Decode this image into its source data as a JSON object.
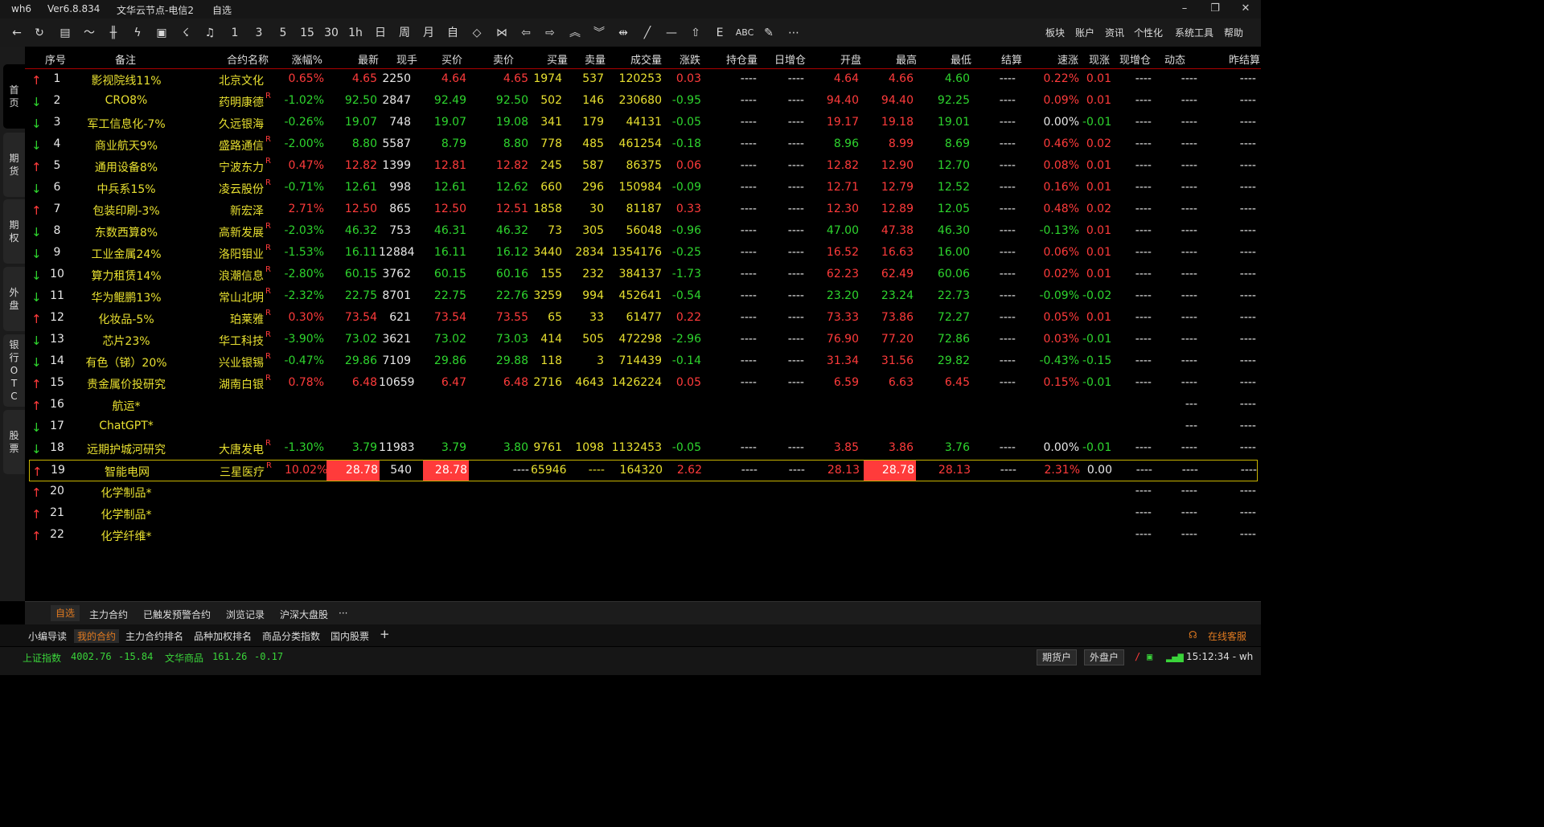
{
  "titlebar": {
    "app": "wh6",
    "version": "Ver6.8.834",
    "node": "文华云节点-电信2",
    "page": "自选"
  },
  "toolbar": {
    "icons": [
      "back-icon",
      "refresh-icon",
      "table-icon",
      "line-chart-icon",
      "candlestick-icon",
      "lightning-icon",
      "tape-icon",
      "cloud-lightning-icon",
      "bell-icon"
    ],
    "periods": [
      "1",
      "3",
      "5",
      "15",
      "30",
      "1h",
      "日",
      "周",
      "月",
      "自"
    ],
    "tools": [
      "diamond-icon",
      "bowtie-icon",
      "arrow-left-icon",
      "arrow-right-icon",
      "double-up-icon",
      "double-down-icon",
      "range-icon",
      "diagonal-line-icon",
      "horizontal-line-icon",
      "home-icon",
      "text-e-icon",
      "abc-icon",
      "pen-icon",
      "more-icon"
    ],
    "menu": [
      "板块",
      "账户",
      "资讯",
      "个性化",
      "系统工具",
      "帮助"
    ]
  },
  "leftbar": {
    "tabs": [
      "首页",
      "期货",
      "期权",
      "外盘",
      "银行OTC",
      "股票"
    ]
  },
  "columns": [
    "序号",
    "备注",
    "合约名称",
    "涨幅%",
    "最新",
    "现手",
    "买价",
    "卖价",
    "买量",
    "卖量",
    "成交量",
    "涨跌",
    "持仓量",
    "日增仓",
    "开盘",
    "最高",
    "最低",
    "结算",
    "速涨",
    "现涨",
    "现增仓",
    "动态",
    "昨结算"
  ],
  "rows": [
    {
      "dir": "up",
      "no": "1",
      "note": "影视院线11%",
      "name": "北京文化",
      "r": "",
      "pct": "0.65%",
      "last": "4.65",
      "vol": "2250",
      "bid": "4.64",
      "ask": "4.65",
      "bidv": "1974",
      "askv": "537",
      "turn": "120253",
      "chg": "0.03",
      "oi": "----",
      "doi": "----",
      "open": "4.64",
      "high": "4.66",
      "low": "4.60",
      "settle": "----",
      "speed": "0.22%",
      "nowchg": "0.01",
      "nowoi": "----",
      "dyn": "----",
      "prev": "----",
      "cpct": "up",
      "clast": "up",
      "cbid": "up",
      "cask": "up",
      "cchg": "up",
      "copen": "up",
      "chigh": "up",
      "clow": "dn",
      "cspeed": "up",
      "cnow": "up"
    },
    {
      "dir": "dn",
      "no": "2",
      "note": "CRO8%",
      "name": "药明康德",
      "r": "R",
      "pct": "-1.02%",
      "last": "92.50",
      "vol": "2847",
      "bid": "92.49",
      "ask": "92.50",
      "bidv": "502",
      "askv": "146",
      "turn": "230680",
      "chg": "-0.95",
      "oi": "----",
      "doi": "----",
      "open": "94.40",
      "high": "94.40",
      "low": "92.25",
      "settle": "----",
      "speed": "0.09%",
      "nowchg": "0.01",
      "nowoi": "----",
      "dyn": "----",
      "prev": "----",
      "cpct": "dn",
      "clast": "dn",
      "cbid": "dn",
      "cask": "dn",
      "cchg": "dn",
      "copen": "up",
      "chigh": "up",
      "clow": "dn",
      "cspeed": "up",
      "cnow": "up"
    },
    {
      "dir": "dn",
      "no": "3",
      "note": "军工信息化-7%",
      "name": "久远银海",
      "r": "",
      "pct": "-0.26%",
      "last": "19.07",
      "vol": "748",
      "bid": "19.07",
      "ask": "19.08",
      "bidv": "341",
      "askv": "179",
      "turn": "44131",
      "chg": "-0.05",
      "oi": "----",
      "doi": "----",
      "open": "19.17",
      "high": "19.18",
      "low": "19.01",
      "settle": "----",
      "speed": "0.00%",
      "nowchg": "-0.01",
      "nowoi": "----",
      "dyn": "----",
      "prev": "----",
      "cpct": "dn",
      "clast": "dn",
      "cbid": "dn",
      "cask": "dn",
      "cchg": "dn",
      "copen": "up",
      "chigh": "up",
      "clow": "dn",
      "cspeed": "wh",
      "cnow": "dn"
    },
    {
      "dir": "dn",
      "no": "4",
      "note": "商业航天9%",
      "name": "盛路通信",
      "r": "R",
      "pct": "-2.00%",
      "last": "8.80",
      "vol": "5587",
      "bid": "8.79",
      "ask": "8.80",
      "bidv": "778",
      "askv": "485",
      "turn": "461254",
      "chg": "-0.18",
      "oi": "----",
      "doi": "----",
      "open": "8.96",
      "high": "8.99",
      "low": "8.69",
      "settle": "----",
      "speed": "0.46%",
      "nowchg": "0.02",
      "nowoi": "----",
      "dyn": "----",
      "prev": "----",
      "cpct": "dn",
      "clast": "dn",
      "cbid": "dn",
      "cask": "dn",
      "cchg": "dn",
      "copen": "dn",
      "chigh": "up",
      "clow": "dn",
      "cspeed": "up",
      "cnow": "up"
    },
    {
      "dir": "up",
      "no": "5",
      "note": "通用设备8%",
      "name": "宁波东力",
      "r": "R",
      "pct": "0.47%",
      "last": "12.82",
      "vol": "1399",
      "bid": "12.81",
      "ask": "12.82",
      "bidv": "245",
      "askv": "587",
      "turn": "86375",
      "chg": "0.06",
      "oi": "----",
      "doi": "----",
      "open": "12.82",
      "high": "12.90",
      "low": "12.70",
      "settle": "----",
      "speed": "0.08%",
      "nowchg": "0.01",
      "nowoi": "----",
      "dyn": "----",
      "prev": "----",
      "cpct": "up",
      "clast": "up",
      "cbid": "up",
      "cask": "up",
      "cchg": "up",
      "copen": "up",
      "chigh": "up",
      "clow": "dn",
      "cspeed": "up",
      "cnow": "up"
    },
    {
      "dir": "dn",
      "no": "6",
      "note": "中兵系15%",
      "name": "凌云股份",
      "r": "R",
      "pct": "-0.71%",
      "last": "12.61",
      "vol": "998",
      "bid": "12.61",
      "ask": "12.62",
      "bidv": "660",
      "askv": "296",
      "turn": "150984",
      "chg": "-0.09",
      "oi": "----",
      "doi": "----",
      "open": "12.71",
      "high": "12.79",
      "low": "12.52",
      "settle": "----",
      "speed": "0.16%",
      "nowchg": "0.01",
      "nowoi": "----",
      "dyn": "----",
      "prev": "----",
      "cpct": "dn",
      "clast": "dn",
      "cbid": "dn",
      "cask": "dn",
      "cchg": "dn",
      "copen": "up",
      "chigh": "up",
      "clow": "dn",
      "cspeed": "up",
      "cnow": "up"
    },
    {
      "dir": "up",
      "no": "7",
      "note": "包装印刷-3%",
      "name": "新宏泽",
      "r": "",
      "pct": "2.71%",
      "last": "12.50",
      "vol": "865",
      "bid": "12.50",
      "ask": "12.51",
      "bidv": "1858",
      "askv": "30",
      "turn": "81187",
      "chg": "0.33",
      "oi": "----",
      "doi": "----",
      "open": "12.30",
      "high": "12.89",
      "low": "12.05",
      "settle": "----",
      "speed": "0.48%",
      "nowchg": "0.02",
      "nowoi": "----",
      "dyn": "----",
      "prev": "----",
      "cpct": "up",
      "clast": "up",
      "cbid": "up",
      "cask": "up",
      "cchg": "up",
      "copen": "up",
      "chigh": "up",
      "clow": "dn",
      "cspeed": "up",
      "cnow": "up"
    },
    {
      "dir": "dn",
      "no": "8",
      "note": "东数西算8%",
      "name": "高新发展",
      "r": "R",
      "pct": "-2.03%",
      "last": "46.32",
      "vol": "753",
      "bid": "46.31",
      "ask": "46.32",
      "bidv": "73",
      "askv": "305",
      "turn": "56048",
      "chg": "-0.96",
      "oi": "----",
      "doi": "----",
      "open": "47.00",
      "high": "47.38",
      "low": "46.30",
      "settle": "----",
      "speed": "-0.13%",
      "nowchg": "0.01",
      "nowoi": "----",
      "dyn": "----",
      "prev": "----",
      "cpct": "dn",
      "clast": "dn",
      "cbid": "dn",
      "cask": "dn",
      "cchg": "dn",
      "copen": "dn",
      "chigh": "up",
      "clow": "dn",
      "cspeed": "dn",
      "cnow": "up"
    },
    {
      "dir": "dn",
      "no": "9",
      "note": "工业金属24%",
      "name": "洛阳钼业",
      "r": "R",
      "pct": "-1.53%",
      "last": "16.11",
      "vol": "12884",
      "bid": "16.11",
      "ask": "16.12",
      "bidv": "3440",
      "askv": "2834",
      "turn": "1354176",
      "chg": "-0.25",
      "oi": "----",
      "doi": "----",
      "open": "16.52",
      "high": "16.63",
      "low": "16.00",
      "settle": "----",
      "speed": "0.06%",
      "nowchg": "0.01",
      "nowoi": "----",
      "dyn": "----",
      "prev": "----",
      "cpct": "dn",
      "clast": "dn",
      "cbid": "dn",
      "cask": "dn",
      "cchg": "dn",
      "copen": "up",
      "chigh": "up",
      "clow": "dn",
      "cspeed": "up",
      "cnow": "up"
    },
    {
      "dir": "dn",
      "no": "10",
      "note": "算力租赁14%",
      "name": "浪潮信息",
      "r": "R",
      "pct": "-2.80%",
      "last": "60.15",
      "vol": "3762",
      "bid": "60.15",
      "ask": "60.16",
      "bidv": "155",
      "askv": "232",
      "turn": "384137",
      "chg": "-1.73",
      "oi": "----",
      "doi": "----",
      "open": "62.23",
      "high": "62.49",
      "low": "60.06",
      "settle": "----",
      "speed": "0.02%",
      "nowchg": "0.01",
      "nowoi": "----",
      "dyn": "----",
      "prev": "----",
      "cpct": "dn",
      "clast": "dn",
      "cbid": "dn",
      "cask": "dn",
      "cchg": "dn",
      "copen": "up",
      "chigh": "up",
      "clow": "dn",
      "cspeed": "up",
      "cnow": "up"
    },
    {
      "dir": "dn",
      "no": "11",
      "note": "华为鲲鹏13%",
      "name": "常山北明",
      "r": "R",
      "pct": "-2.32%",
      "last": "22.75",
      "vol": "8701",
      "bid": "22.75",
      "ask": "22.76",
      "bidv": "3259",
      "askv": "994",
      "turn": "452641",
      "chg": "-0.54",
      "oi": "----",
      "doi": "----",
      "open": "23.20",
      "high": "23.24",
      "low": "22.73",
      "settle": "----",
      "speed": "-0.09%",
      "nowchg": "-0.02",
      "nowoi": "----",
      "dyn": "----",
      "prev": "----",
      "cpct": "dn",
      "clast": "dn",
      "cbid": "dn",
      "cask": "dn",
      "cchg": "dn",
      "copen": "dn",
      "chigh": "dn",
      "clow": "dn",
      "cspeed": "dn",
      "cnow": "dn"
    },
    {
      "dir": "up",
      "no": "12",
      "note": "化妆品-5%",
      "name": "珀莱雅",
      "r": "R",
      "pct": "0.30%",
      "last": "73.54",
      "vol": "621",
      "bid": "73.54",
      "ask": "73.55",
      "bidv": "65",
      "askv": "33",
      "turn": "61477",
      "chg": "0.22",
      "oi": "----",
      "doi": "----",
      "open": "73.33",
      "high": "73.86",
      "low": "72.27",
      "settle": "----",
      "speed": "0.05%",
      "nowchg": "0.01",
      "nowoi": "----",
      "dyn": "----",
      "prev": "----",
      "cpct": "up",
      "clast": "up",
      "cbid": "up",
      "cask": "up",
      "cchg": "up",
      "copen": "up",
      "chigh": "up",
      "clow": "dn",
      "cspeed": "up",
      "cnow": "up"
    },
    {
      "dir": "dn",
      "no": "13",
      "note": "芯片23%",
      "name": "华工科技",
      "r": "R",
      "pct": "-3.90%",
      "last": "73.02",
      "vol": "3621",
      "bid": "73.02",
      "ask": "73.03",
      "bidv": "414",
      "askv": "505",
      "turn": "472298",
      "chg": "-2.96",
      "oi": "----",
      "doi": "----",
      "open": "76.90",
      "high": "77.20",
      "low": "72.86",
      "settle": "----",
      "speed": "0.03%",
      "nowchg": "-0.01",
      "nowoi": "----",
      "dyn": "----",
      "prev": "----",
      "cpct": "dn",
      "clast": "dn",
      "cbid": "dn",
      "cask": "dn",
      "cchg": "dn",
      "copen": "up",
      "chigh": "up",
      "clow": "dn",
      "cspeed": "up",
      "cnow": "dn"
    },
    {
      "dir": "dn",
      "no": "14",
      "note": "有色（锑）20%",
      "name": "兴业银锡",
      "r": "R",
      "pct": "-0.47%",
      "last": "29.86",
      "vol": "7109",
      "bid": "29.86",
      "ask": "29.88",
      "bidv": "118",
      "askv": "3",
      "turn": "714439",
      "chg": "-0.14",
      "oi": "----",
      "doi": "----",
      "open": "31.34",
      "high": "31.56",
      "low": "29.82",
      "settle": "----",
      "speed": "-0.43%",
      "nowchg": "-0.15",
      "nowoi": "----",
      "dyn": "----",
      "prev": "----",
      "cpct": "dn",
      "clast": "dn",
      "cbid": "dn",
      "cask": "dn",
      "cchg": "dn",
      "copen": "up",
      "chigh": "up",
      "clow": "dn",
      "cspeed": "dn",
      "cnow": "dn"
    },
    {
      "dir": "up",
      "no": "15",
      "note": "贵金属价投研究",
      "name": "湖南白银",
      "r": "R",
      "pct": "0.78%",
      "last": "6.48",
      "vol": "10659",
      "bid": "6.47",
      "ask": "6.48",
      "bidv": "2716",
      "askv": "4643",
      "turn": "1426224",
      "chg": "0.05",
      "oi": "----",
      "doi": "----",
      "open": "6.59",
      "high": "6.63",
      "low": "6.45",
      "settle": "----",
      "speed": "0.15%",
      "nowchg": "-0.01",
      "nowoi": "----",
      "dyn": "----",
      "prev": "----",
      "cpct": "up",
      "clast": "up",
      "cbid": "up",
      "cask": "up",
      "cchg": "up",
      "copen": "up",
      "chigh": "up",
      "clow": "up",
      "cspeed": "up",
      "cnow": "dn"
    },
    {
      "dir": "up",
      "no": "16",
      "note": "航运*",
      "name": "",
      "r": "",
      "pct": "",
      "last": "",
      "vol": "",
      "bid": "",
      "ask": "",
      "bidv": "",
      "askv": "",
      "turn": "",
      "chg": "",
      "oi": "",
      "doi": "",
      "open": "",
      "high": "",
      "low": "",
      "settle": "",
      "speed": "",
      "nowchg": "",
      "nowoi": "",
      "dyn": "---",
      "prev": "----"
    },
    {
      "dir": "dn",
      "no": "17",
      "note": "ChatGPT*",
      "name": "",
      "r": "",
      "pct": "",
      "last": "",
      "vol": "",
      "bid": "",
      "ask": "",
      "bidv": "",
      "askv": "",
      "turn": "",
      "chg": "",
      "oi": "",
      "doi": "",
      "open": "",
      "high": "",
      "low": "",
      "settle": "",
      "speed": "",
      "nowchg": "",
      "nowoi": "",
      "dyn": "---",
      "prev": "----"
    },
    {
      "dir": "dn",
      "no": "18",
      "note": "远期护城河研究",
      "name": "大唐发电",
      "r": "R",
      "pct": "-1.30%",
      "last": "3.79",
      "vol": "11983",
      "bid": "3.79",
      "ask": "3.80",
      "bidv": "9761",
      "askv": "1098",
      "turn": "1132453",
      "chg": "-0.05",
      "oi": "----",
      "doi": "----",
      "open": "3.85",
      "high": "3.86",
      "low": "3.76",
      "settle": "----",
      "speed": "0.00%",
      "nowchg": "-0.01",
      "nowoi": "----",
      "dyn": "----",
      "prev": "----",
      "cpct": "dn",
      "clast": "dn",
      "cbid": "dn",
      "cask": "dn",
      "cchg": "dn",
      "copen": "up",
      "chigh": "up",
      "clow": "dn",
      "cspeed": "wh",
      "cnow": "dn"
    },
    {
      "dir": "up",
      "no": "19",
      "note": "智能电网",
      "name": "三星医疗",
      "r": "R",
      "pct": "10.02%",
      "last": "28.78",
      "vol": "540",
      "bid": "28.78",
      "ask": "----",
      "bidv": "65946",
      "askv": "----",
      "turn": "164320",
      "chg": "2.62",
      "oi": "----",
      "doi": "----",
      "open": "28.13",
      "high": "28.78",
      "low": "28.13",
      "settle": "----",
      "speed": "2.31%",
      "nowchg": "0.00",
      "nowoi": "----",
      "dyn": "----",
      "prev": "----",
      "cpct": "up",
      "clast": "up",
      "cbid": "up",
      "cask": "wh",
      "cchg": "up",
      "copen": "up",
      "chigh": "up",
      "clow": "up",
      "cspeed": "up",
      "cnow": "wh",
      "selected": true
    },
    {
      "dir": "up",
      "no": "20",
      "note": "化学制品*",
      "name": "",
      "r": "",
      "pct": "",
      "last": "",
      "vol": "",
      "bid": "",
      "ask": "",
      "bidv": "",
      "askv": "",
      "turn": "",
      "chg": "",
      "oi": "",
      "doi": "",
      "open": "",
      "high": "",
      "low": "",
      "settle": "",
      "speed": "",
      "nowchg": "",
      "nowoi": "----",
      "dyn": "----",
      "prev": "----"
    },
    {
      "dir": "up",
      "no": "21",
      "note": "化学制品*",
      "name": "",
      "r": "",
      "pct": "",
      "last": "",
      "vol": "",
      "bid": "",
      "ask": "",
      "bidv": "",
      "askv": "",
      "turn": "",
      "chg": "",
      "oi": "",
      "doi": "",
      "open": "",
      "high": "",
      "low": "",
      "settle": "",
      "speed": "",
      "nowchg": "",
      "nowoi": "----",
      "dyn": "----",
      "prev": "----"
    },
    {
      "dir": "up",
      "no": "22",
      "note": "化学纤维*",
      "name": "",
      "r": "",
      "pct": "",
      "last": "",
      "vol": "",
      "bid": "",
      "ask": "",
      "bidv": "",
      "askv": "",
      "turn": "",
      "chg": "",
      "oi": "",
      "doi": "",
      "open": "",
      "high": "",
      "low": "",
      "settle": "",
      "speed": "",
      "nowchg": "",
      "nowoi": "----",
      "dyn": "----",
      "prev": "----"
    }
  ],
  "bottom_tabs": {
    "items": [
      "自选",
      "主力合约",
      "已触发预警合约",
      "浏览记录",
      "沪深大盘股"
    ],
    "more": "···"
  },
  "sub_tabs": {
    "items": [
      "小编导读",
      "我的合约",
      "主力合约排名",
      "品种加权排名",
      "商品分类指数",
      "国内股票"
    ],
    "add": "+",
    "service": "在线客服"
  },
  "status": {
    "idx1_name": "上证指数",
    "idx1_val": "4002.76",
    "idx1_chg": "-15.84",
    "idx2_name": "文华商品",
    "idx2_val": "161.26",
    "idx2_chg": "-0.17",
    "btn1": "期货户",
    "btn2": "外盘户",
    "time": "15:12:34 - wh"
  },
  "colors": {
    "up": "#ff3b3b",
    "down": "#2ed52e",
    "accent": "#e07a20",
    "highlight": "#ff3b3b"
  }
}
